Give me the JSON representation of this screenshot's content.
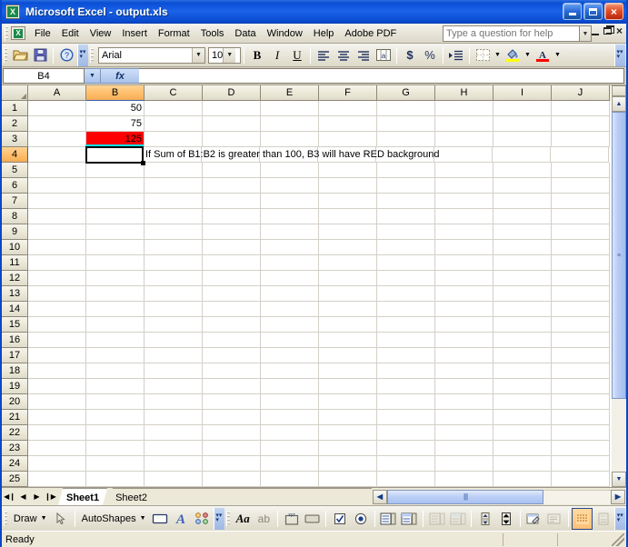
{
  "window": {
    "title": "Microsoft Excel - output.xls",
    "app_icon": "excel-icon",
    "minimize_label": "Minimize",
    "maximize_label": "Maximize",
    "close_label": "Close"
  },
  "menubar": {
    "items": [
      {
        "label": "File"
      },
      {
        "label": "Edit"
      },
      {
        "label": "View"
      },
      {
        "label": "Insert"
      },
      {
        "label": "Format"
      },
      {
        "label": "Tools"
      },
      {
        "label": "Data"
      },
      {
        "label": "Window"
      },
      {
        "label": "Help"
      },
      {
        "label": "Adobe PDF"
      }
    ],
    "ask_placeholder": "Type a question for help",
    "ask_value": ""
  },
  "toolbar": {
    "font_name": "Arial",
    "font_size": "10",
    "buttons": [
      {
        "name": "open-icon",
        "glyph": "📂"
      },
      {
        "name": "save-icon",
        "glyph": "💾"
      },
      {
        "name": "help-icon",
        "glyph": "?"
      },
      {
        "name": "bold-button",
        "glyph": "B"
      },
      {
        "name": "italic-button",
        "glyph": "I"
      },
      {
        "name": "underline-button",
        "glyph": "U"
      },
      {
        "name": "align-left-button",
        "glyph": "☰"
      },
      {
        "name": "align-center-button",
        "glyph": "☰"
      },
      {
        "name": "align-right-button",
        "glyph": "☰"
      },
      {
        "name": "merge-center-button",
        "glyph": "a"
      },
      {
        "name": "currency-button",
        "glyph": "$"
      },
      {
        "name": "percent-button",
        "glyph": "%"
      },
      {
        "name": "increase-indent-button",
        "glyph": "⇥"
      },
      {
        "name": "borders-button",
        "glyph": "▦"
      },
      {
        "name": "fill-color-button",
        "glyph": "◢"
      },
      {
        "name": "font-color-button",
        "glyph": "A"
      }
    ]
  },
  "formula_bar": {
    "name_box": "B4",
    "formula_value": "",
    "fx_label": "fx"
  },
  "sheet": {
    "columns": [
      "A",
      "B",
      "C",
      "D",
      "E",
      "F",
      "G",
      "H",
      "I",
      "J"
    ],
    "selected_column": "B",
    "selected_row": 4,
    "active_cell": "B4",
    "rows": [
      {
        "n": 1,
        "cells": {
          "B": "50"
        }
      },
      {
        "n": 2,
        "cells": {
          "B": "75"
        }
      },
      {
        "n": 3,
        "cells": {
          "B": "125"
        }
      },
      {
        "n": 4,
        "cells": {
          "C": "If Sum of B1:B2 is greater than 100, B3 will have RED background"
        }
      },
      {
        "n": 5,
        "cells": {}
      },
      {
        "n": 6,
        "cells": {}
      },
      {
        "n": 7,
        "cells": {}
      },
      {
        "n": 8,
        "cells": {}
      },
      {
        "n": 9,
        "cells": {}
      },
      {
        "n": 10,
        "cells": {}
      },
      {
        "n": 11,
        "cells": {}
      },
      {
        "n": 12,
        "cells": {}
      },
      {
        "n": 13,
        "cells": {}
      },
      {
        "n": 14,
        "cells": {}
      },
      {
        "n": 15,
        "cells": {}
      },
      {
        "n": 16,
        "cells": {}
      },
      {
        "n": 17,
        "cells": {}
      },
      {
        "n": 18,
        "cells": {}
      },
      {
        "n": 19,
        "cells": {}
      },
      {
        "n": 20,
        "cells": {}
      },
      {
        "n": 21,
        "cells": {}
      },
      {
        "n": 22,
        "cells": {}
      },
      {
        "n": 23,
        "cells": {}
      },
      {
        "n": 24,
        "cells": {}
      },
      {
        "n": 25,
        "cells": {}
      }
    ],
    "highlight_cell": "B3",
    "highlight_color": "#FF0000"
  },
  "tabs": {
    "items": [
      {
        "label": "Sheet1",
        "active": true
      },
      {
        "label": "Sheet2",
        "active": false
      }
    ],
    "nav_first": "◀❙",
    "nav_prev": "◀",
    "nav_next": "▶",
    "nav_last": "❙▶"
  },
  "drawing_toolbar": {
    "draw_label": "Draw",
    "autoshapes_label": "AutoShapes",
    "buttons": [
      {
        "name": "select-objects-icon",
        "glyph": "↖"
      },
      {
        "name": "rectangle-icon",
        "glyph": "▭"
      },
      {
        "name": "wordart-icon",
        "glyph": "A"
      },
      {
        "name": "diagram-icon",
        "glyph": "⚭"
      },
      {
        "name": "font-large-icon",
        "glyph": "Aa"
      },
      {
        "name": "label-icon",
        "glyph": "ab"
      },
      {
        "name": "group-box-icon",
        "glyph": "▢"
      },
      {
        "name": "button-control-icon",
        "glyph": "▬"
      },
      {
        "name": "check-box-icon",
        "glyph": "☑"
      },
      {
        "name": "option-button-icon",
        "glyph": "◉"
      },
      {
        "name": "list-box-icon",
        "glyph": "≡"
      },
      {
        "name": "combo-box-icon",
        "glyph": "≣"
      },
      {
        "name": "combo-list-edit-icon",
        "glyph": "≡"
      },
      {
        "name": "combo-drop-down-icon",
        "glyph": "≣"
      },
      {
        "name": "scroll-bar-icon",
        "glyph": "⇅"
      },
      {
        "name": "spinner-icon",
        "glyph": "⇵"
      },
      {
        "name": "control-properties-icon",
        "glyph": "✎"
      },
      {
        "name": "edit-code-icon",
        "glyph": "▤"
      },
      {
        "name": "toggle-grid-icon",
        "glyph": "▒"
      },
      {
        "name": "run-dialog-icon",
        "glyph": "▧"
      }
    ]
  },
  "statusbar": {
    "message": "Ready"
  }
}
